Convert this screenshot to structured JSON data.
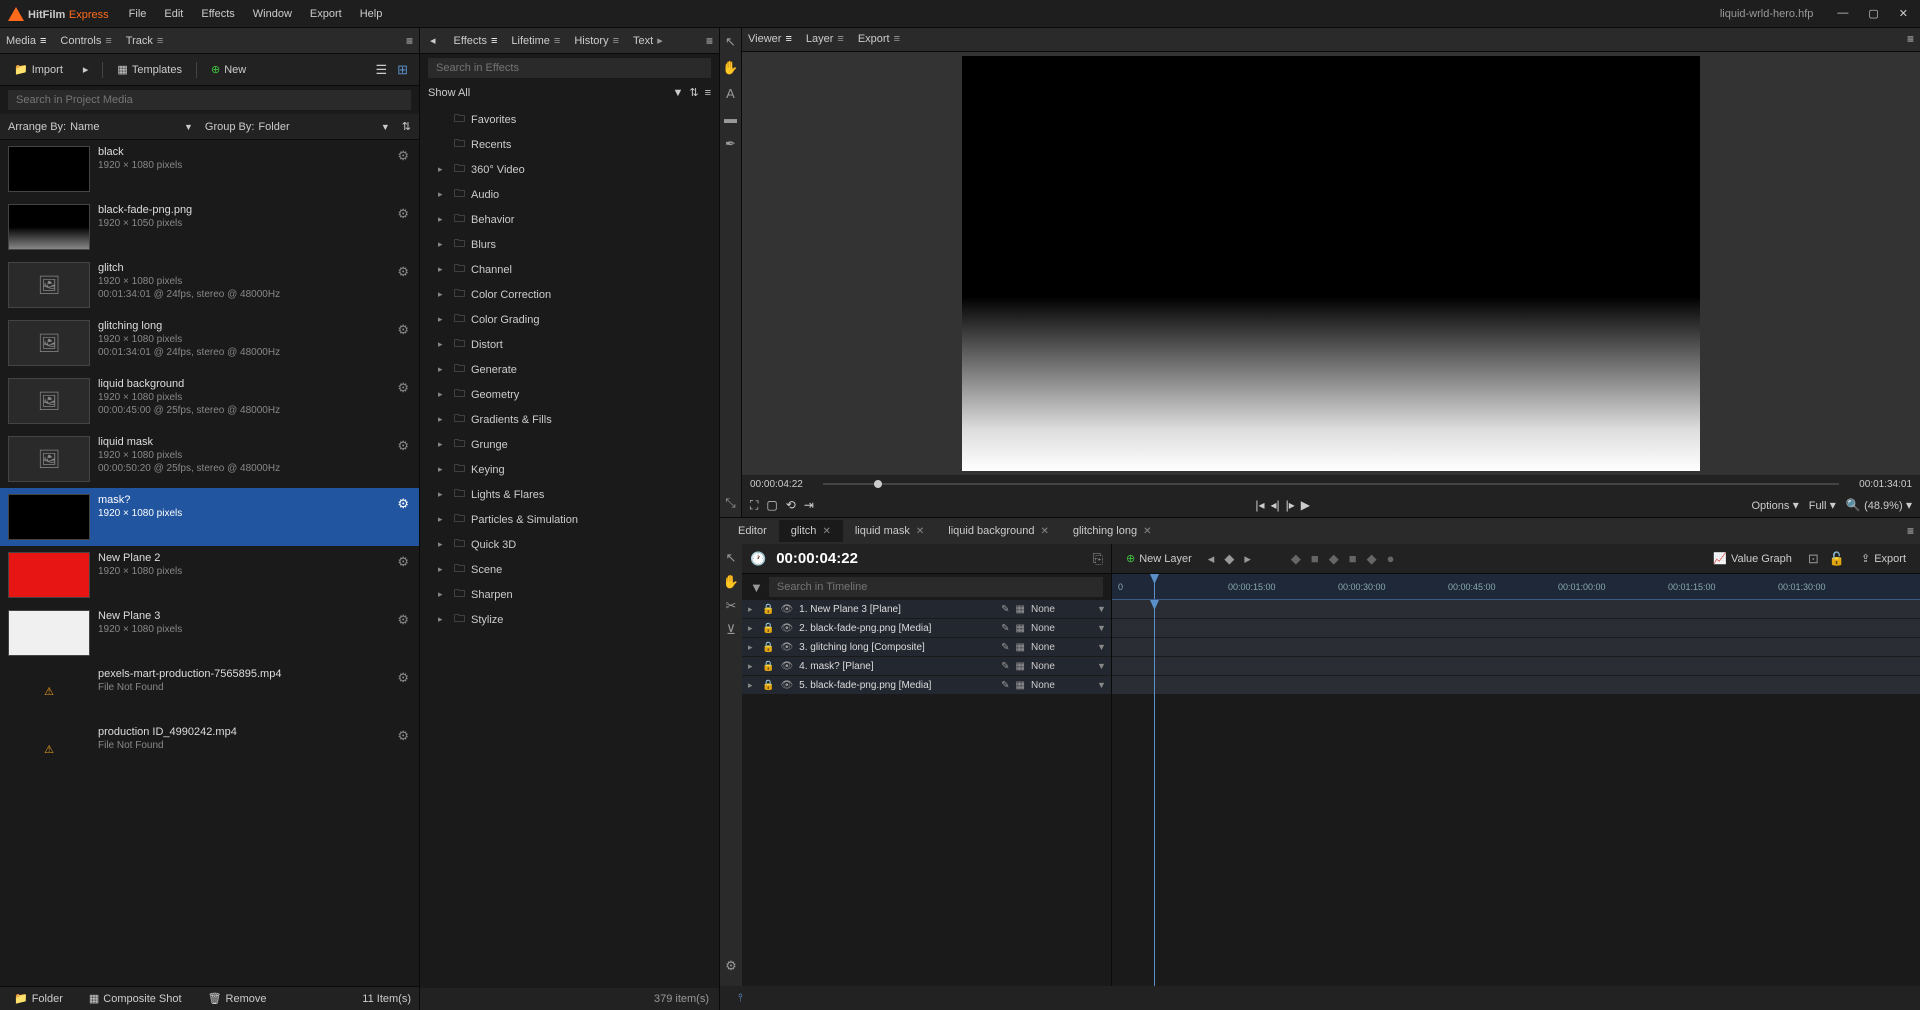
{
  "app": {
    "name": "HitFilm",
    "edition": "Express",
    "project": "liquid-wrld-hero.hfp"
  },
  "menu": [
    "File",
    "Edit",
    "Effects",
    "Window",
    "Export",
    "Help"
  ],
  "leftPanel": {
    "tabs": [
      "Media",
      "Controls",
      "Track"
    ],
    "toolbar": {
      "import": "Import",
      "templates": "Templates",
      "new": "New"
    },
    "searchPlaceholder": "Search in Project Media",
    "arrangeLabel": "Arrange By:",
    "arrangeValue": "Name",
    "groupLabel": "Group By:",
    "groupValue": "Folder",
    "items": [
      {
        "name": "black",
        "meta1": "1920 × 1080 pixels",
        "thumb": "black"
      },
      {
        "name": "black-fade-png.png",
        "meta1": "1920 × 1050 pixels",
        "thumb": "fade"
      },
      {
        "name": "glitch",
        "meta1": "1920 × 1080 pixels",
        "meta2": "00:01:34:01 @ 24fps, stereo @ 48000Hz",
        "thumb": "comp"
      },
      {
        "name": "glitching long",
        "meta1": "1920 × 1080 pixels",
        "meta2": "00:01:34:01 @ 24fps, stereo @ 48000Hz",
        "thumb": "comp"
      },
      {
        "name": "liquid background",
        "meta1": "1920 × 1080 pixels",
        "meta2": "00:00:45:00 @ 25fps, stereo @ 48000Hz",
        "thumb": "comp"
      },
      {
        "name": "liquid mask",
        "meta1": "1920 × 1080 pixels",
        "meta2": "00:00:50:20 @ 25fps, stereo @ 48000Hz",
        "thumb": "comp"
      },
      {
        "name": "mask?",
        "meta1": "1920 × 1080 pixels",
        "thumb": "black",
        "selected": true
      },
      {
        "name": "New Plane 2",
        "meta1": "1920 × 1080 pixels",
        "thumb": "red"
      },
      {
        "name": "New Plane 3",
        "meta1": "1920 × 1080 pixels",
        "thumb": "white"
      },
      {
        "name": "pexels-mart-production-7565895.mp4",
        "meta1": "File Not Found",
        "thumb": "warn"
      },
      {
        "name": "production ID_4990242.mp4",
        "meta1": "File Not Found",
        "thumb": "warn"
      }
    ],
    "footer": {
      "folder": "Folder",
      "comp": "Composite Shot",
      "remove": "Remove",
      "count": "11 Item(s)"
    }
  },
  "effectsPanel": {
    "tabs": [
      "Effects",
      "Lifetime",
      "History",
      "Text"
    ],
    "searchPlaceholder": "Search in Effects",
    "showAll": "Show All",
    "categories": [
      "Favorites",
      "Recents",
      "360° Video",
      "Audio",
      "Behavior",
      "Blurs",
      "Channel",
      "Color Correction",
      "Color Grading",
      "Distort",
      "Generate",
      "Geometry",
      "Gradients & Fills",
      "Grunge",
      "Keying",
      "Lights & Flares",
      "Particles & Simulation",
      "Quick 3D",
      "Scene",
      "Sharpen",
      "Stylize"
    ],
    "count": "379 item(s)"
  },
  "viewer": {
    "tabs": [
      "Viewer",
      "Layer",
      "Export"
    ],
    "timecode": "00:00:04:22",
    "duration": "00:01:34:01",
    "options": "Options",
    "full": "Full",
    "zoom": "(48.9%)"
  },
  "timeline": {
    "tabs": [
      {
        "name": "Editor"
      },
      {
        "name": "glitch",
        "active": true,
        "close": true
      },
      {
        "name": "liquid mask",
        "close": true
      },
      {
        "name": "liquid background",
        "close": true
      },
      {
        "name": "glitching long",
        "close": true
      }
    ],
    "timecode": "00:00:04:22",
    "newLayer": "New Layer",
    "valueGraph": "Value Graph",
    "export": "Export",
    "searchPlaceholder": "Search in Timeline",
    "layers": [
      {
        "n": "1.",
        "name": "New Plane 3 [Plane]",
        "blend": "None"
      },
      {
        "n": "2.",
        "name": "black-fade-png.png [Media]",
        "blend": "None"
      },
      {
        "n": "3.",
        "name": "glitching long [Composite]",
        "blend": "None"
      },
      {
        "n": "4.",
        "name": "mask? [Plane]",
        "blend": "None"
      },
      {
        "n": "5.",
        "name": "black-fade-png.png [Media]",
        "blend": "None"
      }
    ],
    "ruler": [
      "0",
      "00:00:15:00",
      "00:00:30:00",
      "00:00:45:00",
      "00:01:00:00",
      "00:01:15:00",
      "00:01:30:00"
    ]
  }
}
